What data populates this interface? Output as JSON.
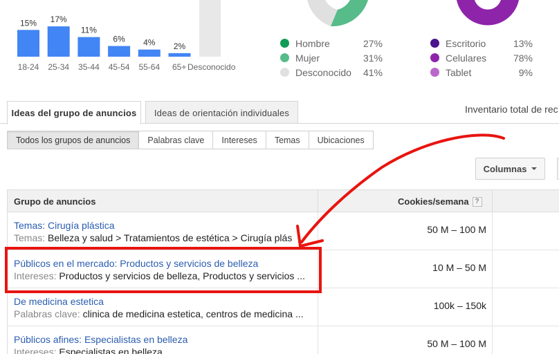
{
  "age_chart": {
    "type": "bar",
    "categories": [
      "18-24",
      "25-34",
      "35-44",
      "45-54",
      "55-64",
      "65+",
      "Desconocido"
    ],
    "values": [
      15,
      17,
      11,
      6,
      4,
      2,
      null
    ],
    "labels": [
      "15%",
      "17%",
      "11%",
      "6%",
      "4%",
      "2%",
      ""
    ],
    "bar_color": "#4285f4",
    "unknown_bar_color": "#e8e8e8"
  },
  "gender_legend": [
    {
      "label": "Hombre",
      "pct": "27%",
      "color": "#0f9d58"
    },
    {
      "label": "Mujer",
      "pct": "31%",
      "color": "#57bb8a"
    },
    {
      "label": "Desconocido",
      "pct": "41%",
      "color": "#e0e0e0"
    }
  ],
  "device_legend": [
    {
      "label": "Escritorio",
      "pct": "13%",
      "color": "#4a148c"
    },
    {
      "label": "Celulares",
      "pct": "78%",
      "color": "#8e24aa"
    },
    {
      "label": "Tablet",
      "pct": "9%",
      "color": "#ba68c8"
    }
  ],
  "tabs": {
    "ideas_grupo": "Ideas del grupo de anuncios",
    "ideas_orientacion": "Ideas de orientación individuales",
    "inventory": "Inventario total de rec"
  },
  "subtabs": [
    "Todos los grupos de anuncios",
    "Palabras clave",
    "Intereses",
    "Temas",
    "Ubicaciones"
  ],
  "columns_button": "Columnas",
  "table": {
    "header_group": "Grupo de anuncios",
    "header_cookies": "Cookies/semana",
    "help_glyph": "?",
    "rows": [
      {
        "title": "Temas: Cirugía plástica",
        "sub_label": "Temas:",
        "sub_value": "Belleza y salud > Tratamientos de estética > Cirugía plás",
        "cookies": "50 M – 100 M"
      },
      {
        "title": "Públicos en el mercado: Productos y servicios de belleza",
        "sub_label": "Intereses:",
        "sub_value": "Productos y servicios de belleza, Productos y servicios ...",
        "cookies": "10 M – 50 M"
      },
      {
        "title": "De medicina estetica",
        "sub_label": "Palabras clave:",
        "sub_value": "clinica de medicina estetica, centros de medicina ...",
        "cookies": "100k – 150k"
      },
      {
        "title": "Públicos afines: Especialistas en belleza",
        "sub_label": "Intereses:",
        "sub_value": "Especialistas en belleza",
        "cookies": "50 M – 100 M"
      }
    ]
  },
  "annotation": {
    "color": "#e8140f"
  }
}
